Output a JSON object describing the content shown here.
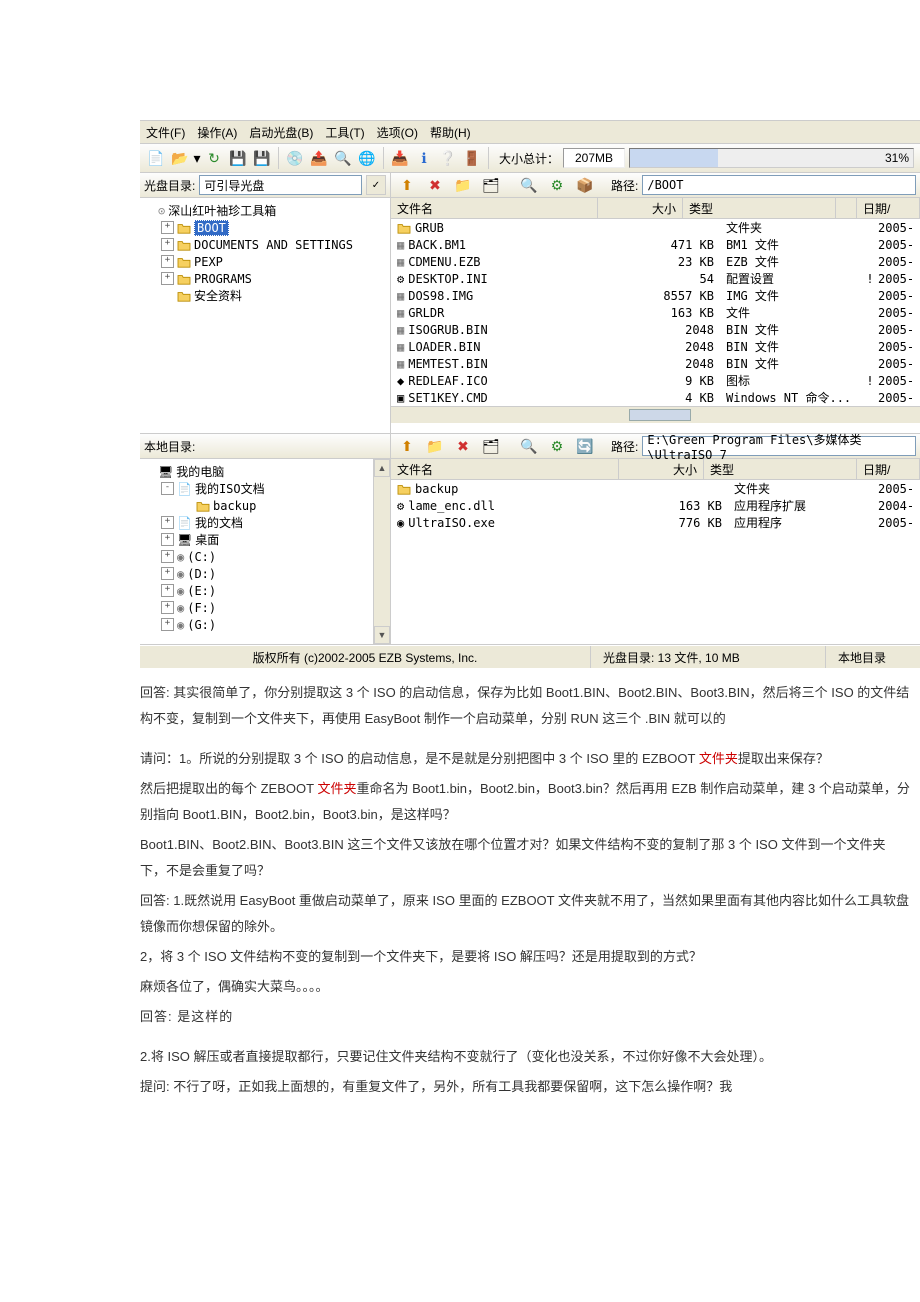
{
  "menu": {
    "file": "文件(F)",
    "action": "操作(A)",
    "boot": "启动光盘(B)",
    "tools": "工具(T)",
    "options": "选项(O)",
    "help": "帮助(H)"
  },
  "toolbar": {
    "size_label": "大小总计：",
    "size_value": "207MB",
    "size_pct": "31%"
  },
  "top_left": {
    "label": "光盘目录:",
    "combo": "可引导光盘",
    "tree": [
      {
        "indent": 0,
        "exp": "",
        "icon": "cd",
        "text": "深山红叶袖珍工具箱",
        "sel": false
      },
      {
        "indent": 1,
        "exp": "+",
        "icon": "folder",
        "text": "BOOT",
        "sel": true
      },
      {
        "indent": 1,
        "exp": "+",
        "icon": "folder",
        "text": "DOCUMENTS AND SETTINGS",
        "sel": false
      },
      {
        "indent": 1,
        "exp": "+",
        "icon": "folder",
        "text": "PEXP",
        "sel": false
      },
      {
        "indent": 1,
        "exp": "+",
        "icon": "folder",
        "text": "PROGRAMS",
        "sel": false
      },
      {
        "indent": 1,
        "exp": "",
        "icon": "folder",
        "text": "安全资料",
        "sel": false
      }
    ]
  },
  "top_right": {
    "path_label": "路径:",
    "path": "/BOOT",
    "cols": {
      "name": "文件名",
      "size": "大小",
      "type": "类型",
      "date": "日期/"
    },
    "rows": [
      {
        "icon": "folder",
        "name": "GRUB",
        "size": "",
        "type": "文件夹",
        "mark": "",
        "date": "2005-"
      },
      {
        "icon": "file",
        "name": "BACK.BM1",
        "size": "471 KB",
        "type": "BM1 文件",
        "mark": "",
        "date": "2005-"
      },
      {
        "icon": "file",
        "name": "CDMENU.EZB",
        "size": "23 KB",
        "type": "EZB 文件",
        "mark": "",
        "date": "2005-"
      },
      {
        "icon": "ini",
        "name": "DESKTOP.INI",
        "size": "54",
        "type": "配置设置",
        "mark": "!",
        "date": "2005-"
      },
      {
        "icon": "file",
        "name": "DOS98.IMG",
        "size": "8557 KB",
        "type": "IMG 文件",
        "mark": "",
        "date": "2005-"
      },
      {
        "icon": "file",
        "name": "GRLDR",
        "size": "163 KB",
        "type": "文件",
        "mark": "",
        "date": "2005-"
      },
      {
        "icon": "file",
        "name": "ISOGRUB.BIN",
        "size": "2048",
        "type": "BIN 文件",
        "mark": "",
        "date": "2005-"
      },
      {
        "icon": "file",
        "name": "LOADER.BIN",
        "size": "2048",
        "type": "BIN 文件",
        "mark": "",
        "date": "2005-"
      },
      {
        "icon": "file",
        "name": "MEMTEST.BIN",
        "size": "2048",
        "type": "BIN 文件",
        "mark": "",
        "date": "2005-"
      },
      {
        "icon": "ico",
        "name": "REDLEAF.ICO",
        "size": "9 KB",
        "type": "图标",
        "mark": "!",
        "date": "2005-"
      },
      {
        "icon": "cmd",
        "name": "SET1KEY.CMD",
        "size": "4 KB",
        "type": "Windows NT 命令...",
        "mark": "",
        "date": "2005-"
      }
    ]
  },
  "bottom_left": {
    "label": "本地目录:",
    "tree": [
      {
        "indent": 0,
        "exp": "",
        "icon": "pc",
        "text": "我的电脑"
      },
      {
        "indent": 1,
        "exp": "-",
        "icon": "doc",
        "text": "我的ISO文档"
      },
      {
        "indent": 2,
        "exp": "",
        "icon": "folder",
        "text": "backup"
      },
      {
        "indent": 1,
        "exp": "+",
        "icon": "doc",
        "text": "我的文档"
      },
      {
        "indent": 1,
        "exp": "+",
        "icon": "desk",
        "text": "桌面"
      },
      {
        "indent": 1,
        "exp": "+",
        "icon": "drive",
        "text": "(C:)"
      },
      {
        "indent": 1,
        "exp": "+",
        "icon": "drive",
        "text": "(D:)"
      },
      {
        "indent": 1,
        "exp": "+",
        "icon": "drive",
        "text": "(E:)"
      },
      {
        "indent": 1,
        "exp": "+",
        "icon": "drive",
        "text": "(F:)"
      },
      {
        "indent": 1,
        "exp": "+",
        "icon": "drive",
        "text": "(G:)"
      }
    ]
  },
  "bottom_right": {
    "path_label": "路径:",
    "path": "E:\\Green Program Files\\多媒体类\\UltraISO 7",
    "cols": {
      "name": "文件名",
      "size": "大小",
      "type": "类型",
      "date": "日期/"
    },
    "rows": [
      {
        "icon": "folder",
        "name": "backup",
        "size": "",
        "type": "文件夹",
        "date": "2005-"
      },
      {
        "icon": "dll",
        "name": "lame_enc.dll",
        "size": "163 KB",
        "type": "应用程序扩展",
        "date": "2004-"
      },
      {
        "icon": "exe",
        "name": "UltraISO.exe",
        "size": "776 KB",
        "type": "应用程序",
        "date": "2005-"
      }
    ]
  },
  "status": {
    "copyright": "版权所有  (c)2002-2005 EZB Systems, Inc.",
    "disc": "光盘目录: 13 文件, 10 MB",
    "local": "本地目录"
  },
  "article": {
    "p1": "回答: 其实很简单了，你分别提取这 3 个 ISO 的启动信息，保存为比如 Boot1.BIN、Boot2.BIN、Boot3.BIN，然后将三个 ISO 的文件结构不变，复制到一个文件夹下，再使用 EasyBoot 制作一个启动菜单，分别 RUN 这三个 .BIN 就可以的",
    "p2a": "请问：1。所说的分别提取 3 个 ISO 的启动信息，是不是就是分别把图中 3 个 ISO 里的 EZBOOT ",
    "p2b": "文件夹",
    "p2c": "提取出来保存？",
    "p3a": "然后把提取出的每个 ZEBOOT ",
    "p3b": "文件夹",
    "p3c": "重命名为 Boot1.bin，Boot2.bin，Boot3.bin？然后再用 EZB 制作启动菜单，建 3 个启动菜单，分别指向 Boot1.BIN，Boot2.bin，Boot3.bin，是这样吗？",
    "p4": "Boot1.BIN、Boot2.BIN、Boot3.BIN 这三个文件又该放在哪个位置才对？如果文件结构不变的复制了那 3 个 ISO 文件到一个文件夹下，不是会重复了吗？",
    "p5": "回答: 1.既然说用 EasyBoot 重做启动菜单了，原来 ISO 里面的 EZBOOT 文件夹就不用了，当然如果里面有其他内容比如什么工具软盘镜像而你想保留的除外。",
    "p6": "2，将 3 个 ISO 文件结构不变的复制到一个文件夹下，是要将 ISO 解压吗？还是用提取到的方式？",
    "p7": "麻烦各位了，偶确实大菜鸟。。。。",
    "p8": "回答: 是这样的",
    "p9": "2.将 ISO 解压或者直接提取都行，只要记住文件夹结构不变就行了（变化也没关系，不过你好像不大会处理）。",
    "p10": "提问: 不行了呀，正如我上面想的，有重复文件了，另外，所有工具我都要保留啊，这下怎么操作啊？我"
  }
}
